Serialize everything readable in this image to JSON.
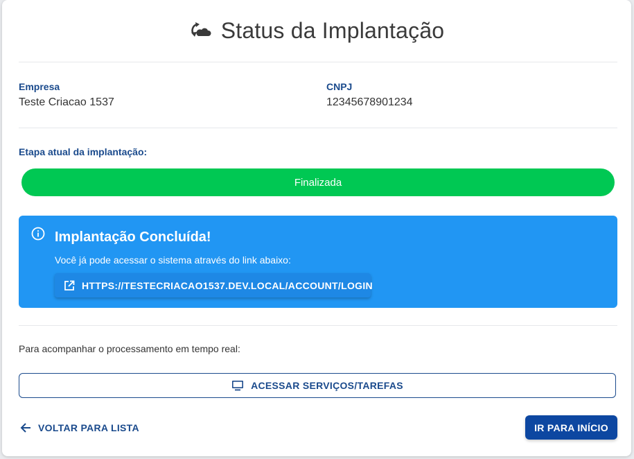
{
  "header": {
    "title": "Status da Implantação",
    "icon": "cloud-sync-icon"
  },
  "company": {
    "empresa_label": "Empresa",
    "empresa_value": "Teste Criacao 1537",
    "cnpj_label": "CNPJ",
    "cnpj_value": "12345678901234"
  },
  "stage": {
    "label": "Etapa atual da implantação:",
    "status": "Finalizada",
    "progress_percent": 100,
    "color": "#00c853"
  },
  "alert": {
    "title": "Implantação Concluída!",
    "text": "Você já pode acessar o sistema através do link abaixo:",
    "link_label": "HTTPS://TESTECRIACAO1537.DEV.LOCAL/ACCOUNT/LOGIN",
    "color": "#2196f3"
  },
  "realtime": {
    "text": "Para acompanhar o processamento em tempo real:",
    "services_button": "ACESSAR SERVIÇOS/TAREFAS"
  },
  "footer": {
    "back_button": "VOLTAR PARA LISTA",
    "home_button": "IR PARA INÍCIO"
  },
  "colors": {
    "primary": "#0d47a1",
    "label": "#1a4a8c"
  }
}
